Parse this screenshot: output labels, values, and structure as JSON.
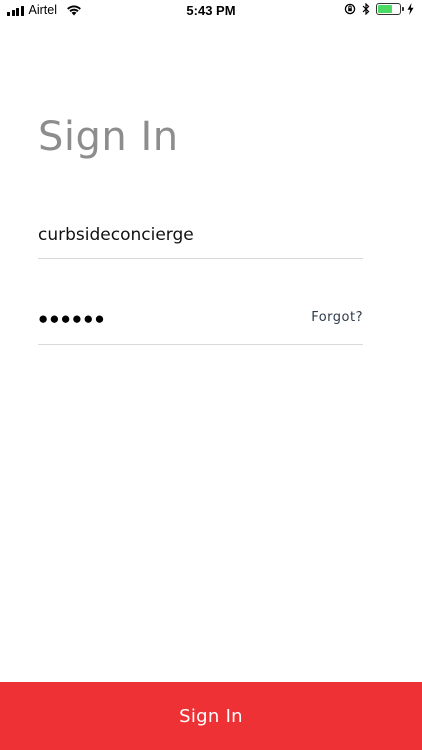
{
  "status_bar": {
    "carrier": "Airtel",
    "time": "5:43 PM",
    "battery_color": "#4cd964"
  },
  "title": "Sign In",
  "username": {
    "value": "curbsideconcierge"
  },
  "password": {
    "masked_value": "●●●●●●",
    "forgot_label": "Forgot?"
  },
  "button": {
    "label": "Sign In",
    "color": "#ee3135"
  }
}
